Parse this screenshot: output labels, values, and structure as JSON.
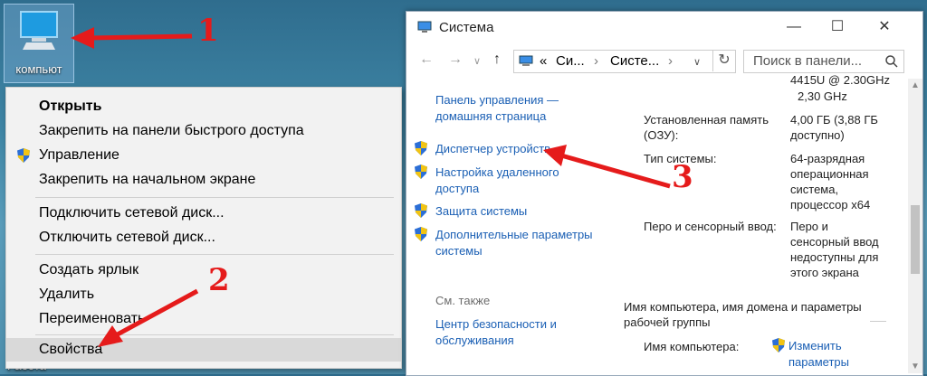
{
  "desktop": {
    "icon_label": "компьют",
    "bottom_label": "Работа"
  },
  "context_menu": {
    "items": [
      {
        "label": "Открыть"
      },
      {
        "label": "Закрепить на панели быстрого доступа"
      },
      {
        "label": "Управление"
      },
      {
        "label": "Закрепить на начальном экране"
      },
      {
        "label": "Подключить сетевой диск..."
      },
      {
        "label": "Отключить сетевой диск..."
      },
      {
        "label": "Создать ярлык"
      },
      {
        "label": "Удалить"
      },
      {
        "label": "Переименовать"
      },
      {
        "label": "Свойства"
      }
    ]
  },
  "window": {
    "title": "Система",
    "address": {
      "sep": "«",
      "crumb1": "Си...",
      "crumb2": "Систе..."
    },
    "search_placeholder": "Поиск в панели...",
    "min": "—",
    "max": "☐",
    "close": "✕"
  },
  "left_links": {
    "home": "Панель управления — домашняя страница",
    "device_manager": "Диспетчер устройств",
    "remote": "Настройка удаленного доступа",
    "protection": "Защита системы",
    "advanced": "Дополнительные параметры системы",
    "see_also": "См. также",
    "security_center": "Центр безопасности и обслуживания"
  },
  "system_info": {
    "cpu_tail1": "4415U @ 2.30GHz",
    "cpu_tail2": "2,30 GHz",
    "ram_label": "Установленная память (ОЗУ):",
    "ram_value": "4,00 ГБ (3,88 ГБ доступно)",
    "type_label": "Тип системы:",
    "type_value": "64-разрядная операционная система, процессор x64",
    "pen_label": "Перо и сенсорный ввод:",
    "pen_value": "Перо и сенсорный ввод недоступны для этого экрана",
    "section": "Имя компьютера, имя домена и параметры рабочей группы",
    "computer_name_label": "Имя компьютера:",
    "change_link": "Изменить параметры"
  },
  "annotations": {
    "n1": "1",
    "n2": "2",
    "n3": "3"
  }
}
